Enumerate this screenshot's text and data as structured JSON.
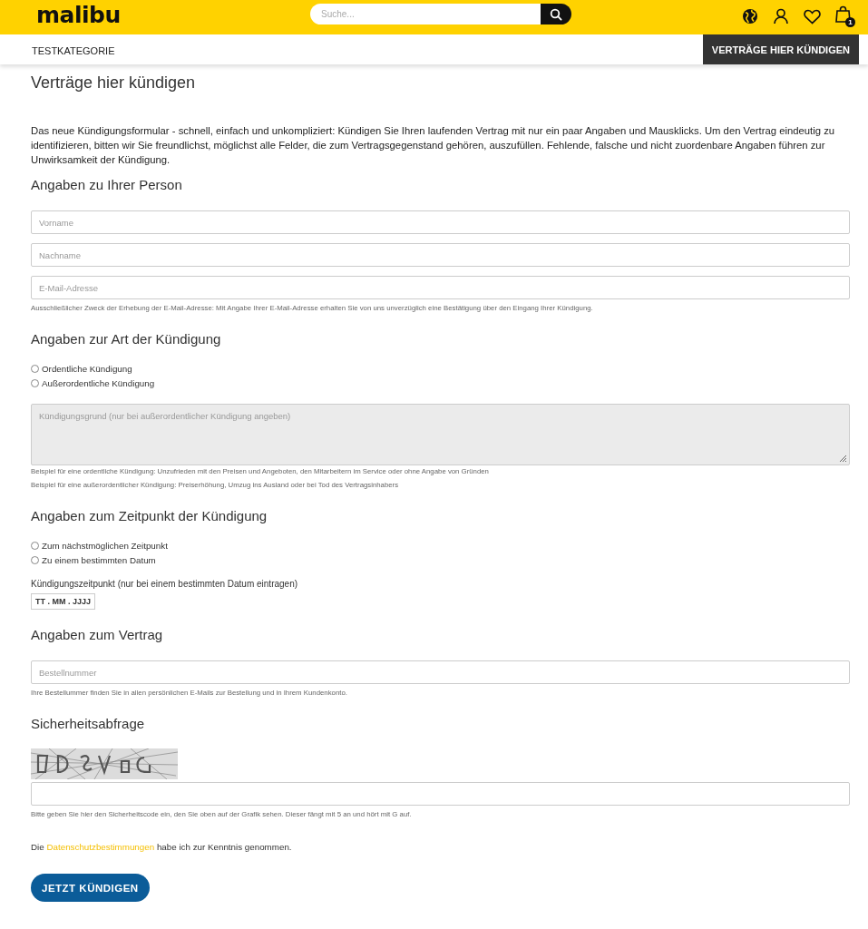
{
  "header": {
    "logo": "malibu",
    "search": {
      "placeholder": "Suche..."
    },
    "cart_count": "1"
  },
  "nav": {
    "items": [
      {
        "label": "TESTKATEGORIE"
      }
    ],
    "cta": "VERTRÄGE HIER KÜNDIGEN"
  },
  "title": "Verträge hier kündigen",
  "intro": "Das neue Kündigungsformular - schnell, einfach und unkompliziert: Kündigen Sie Ihren laufenden Vertrag mit nur ein paar Angaben und Mausklicks. Um den Vertrag eindeutig zu identifizieren, bitten wir Sie freundlichst, möglichst alle Felder, die zum Vertragsgegenstand gehören, auszufüllen. Fehlende, falsche und nicht zuordenbare Angaben führen zur Unwirksamkeit der Kündigung.",
  "sections": [
    {
      "heading": "Angaben zu Ihrer Person",
      "items": [
        {
          "kind": "input",
          "placeholder": "Vorname"
        },
        {
          "kind": "input",
          "placeholder": "Nachname"
        },
        {
          "kind": "input",
          "placeholder": "E-Mail-Adresse"
        },
        {
          "kind": "hint",
          "text": "Ausschließlicher Zweck der Erhebung der E-Mail-Adresse: Mit Angabe Ihrer E-Mail-Adresse erhalten Sie von uns unverzüglich eine Bestätigung über den Eingang Ihrer Kündigung."
        }
      ]
    },
    {
      "heading": "Angaben zur Art der Kündigung",
      "items": [
        {
          "kind": "radio",
          "label": "Ordentliche Kündigung",
          "selected": false
        },
        {
          "kind": "radio",
          "label": "Außerordentliche Kündigung",
          "selected": false
        },
        {
          "kind": "textarea",
          "placeholder": "Kündigungsgrund (nur bei außerordentlicher Kündigung angeben)",
          "disabled": true
        },
        {
          "kind": "hint",
          "text": "Beispiel für eine ordentliche Kündigung: Unzufrieden mit den Preisen und Angeboten, den Mitarbeitern im Service oder ohne Angabe von Gründen"
        },
        {
          "kind": "hint",
          "text": "Beispiel für eine außerordentlicher Kündigung: Preiserhöhung, Umzug ins Ausland oder bei Tod des Vertragsinhabers"
        }
      ]
    },
    {
      "heading": "Angaben zum Zeitpunkt der Kündigung",
      "items": [
        {
          "kind": "radio",
          "label": "Zum nächstmöglichen Zeitpunkt",
          "selected": false
        },
        {
          "kind": "radio",
          "label": "Zu einem bestimmten Datum",
          "selected": false
        },
        {
          "kind": "label",
          "text": "Kündigungszeitpunkt (nur bei einem bestimmten Datum eintragen)"
        },
        {
          "kind": "date",
          "placeholder": "TT . MM . JJJJ"
        }
      ]
    },
    {
      "heading": "Angaben zum Vertrag",
      "items": [
        {
          "kind": "input",
          "placeholder": "Bestellnummer"
        },
        {
          "kind": "hint",
          "text": "Ihre Bestellummer finden Sie in allen persönlichen E-Mails zur Bestellung und in Ihrem Kundenkonto."
        }
      ]
    },
    {
      "heading": "Sicherheitsabfrage",
      "items": [
        {
          "kind": "captcha"
        },
        {
          "kind": "input"
        },
        {
          "kind": "hint",
          "text": "Bitte geben Sie hier den Sicherheitscode ein, den Sie oben auf der Grafik sehen. Dieser fängt mit 5 an und hört mit G auf."
        }
      ]
    }
  ],
  "privacy": {
    "before": "Die ",
    "link": "Datenschutzbestimmungen",
    "after": " habe ich zur Kenntnis genommen."
  },
  "submit": "JETZT KÜNDIGEN"
}
